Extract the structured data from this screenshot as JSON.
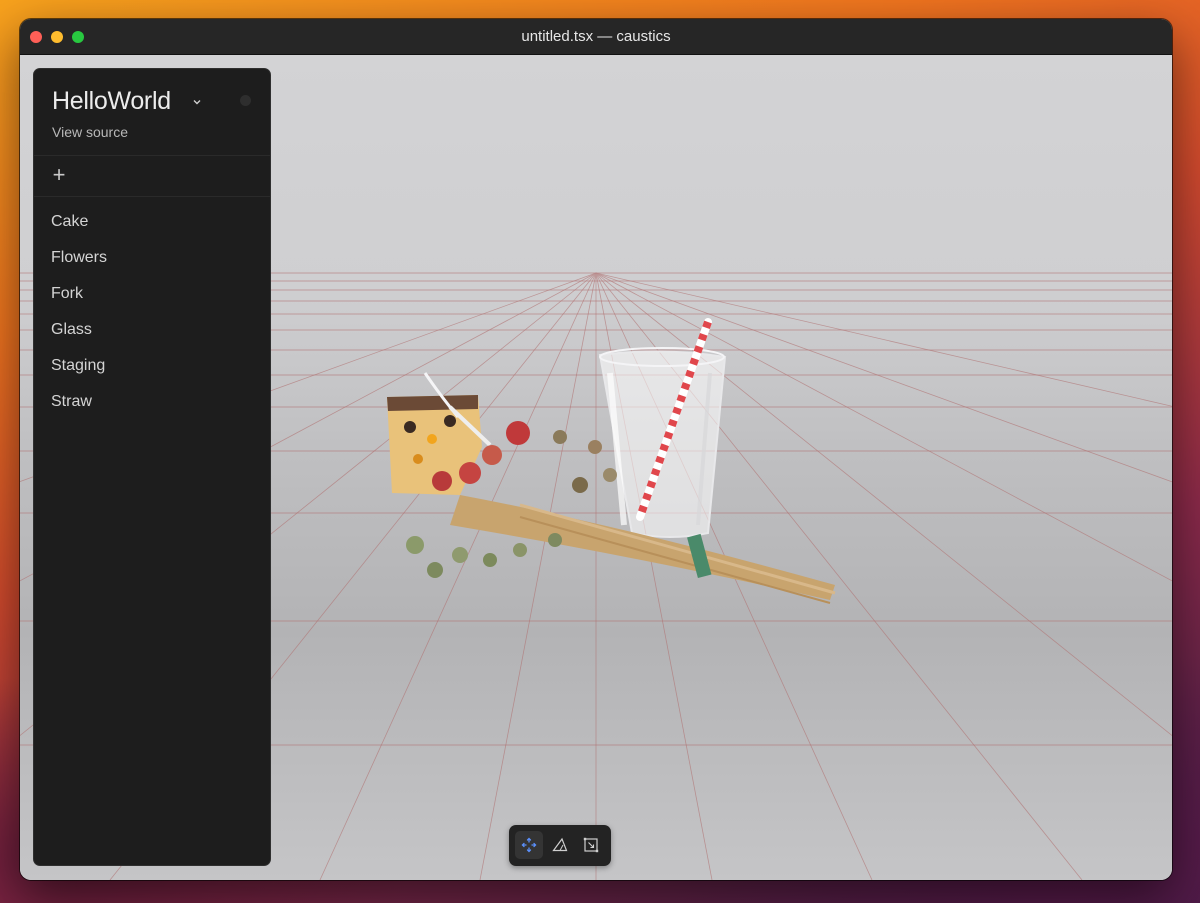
{
  "window": {
    "title": "untitled.tsx — caustics"
  },
  "sidebar": {
    "project_title": "HelloWorld",
    "view_source": "View source",
    "add_label": "+",
    "items": [
      {
        "label": "Cake"
      },
      {
        "label": "Flowers"
      },
      {
        "label": "Fork"
      },
      {
        "label": "Glass"
      },
      {
        "label": "Staging"
      },
      {
        "label": "Straw"
      }
    ]
  },
  "toolbar": {
    "tools": [
      {
        "icon": "move-icon",
        "active": true
      },
      {
        "icon": "triangle-icon",
        "active": false
      },
      {
        "icon": "frame-icon",
        "active": false
      }
    ]
  },
  "icons": {
    "project_menu": "chevron-down-icon",
    "add": "plus-icon"
  },
  "colors": {
    "active_tool": "#5b8ff9",
    "grid_line": "#b07070",
    "sidebar_bg": "#1d1d1d"
  }
}
